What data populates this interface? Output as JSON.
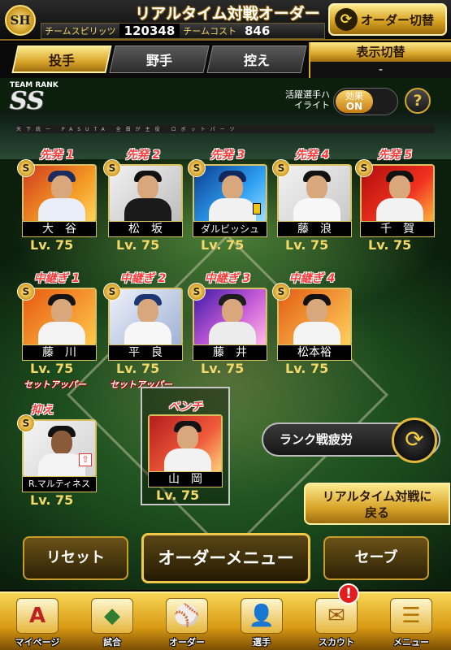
{
  "header": {
    "logo_text": "SH",
    "title": "リアルタイム対戦オーダー",
    "team_spirit_label": "チームスピリッツ",
    "team_spirit_value": "120348",
    "team_cost_label": "チームコスト",
    "team_cost_value": "846",
    "order_switch_label": "オーダー切替"
  },
  "tabs": [
    {
      "label": "投手",
      "active": true
    },
    {
      "label": "野手",
      "active": false
    },
    {
      "label": "控え",
      "active": false
    }
  ],
  "display_switch": {
    "label": "表示切替",
    "value": "-"
  },
  "team_rank": {
    "label": "TEAM RANK",
    "value": "SS"
  },
  "highlight": {
    "label": "活躍選手ハイライト",
    "effect_label": "効果",
    "effect_state": "ON"
  },
  "help_label": "?",
  "stadium_banner": "天下統一 PASUTA 全員が主役 ロボットパーツ",
  "rarity_mark": "S",
  "starters": [
    {
      "slot": "先発 1",
      "name": "大　谷",
      "level": "Lv. 75"
    },
    {
      "slot": "先発 2",
      "name": "松　坂",
      "level": "Lv. 75"
    },
    {
      "slot": "先発 3",
      "name": "ダルビッシュ",
      "level": "Lv. 75"
    },
    {
      "slot": "先発 4",
      "name": "藤　浪",
      "level": "Lv. 75"
    },
    {
      "slot": "先発 5",
      "name": "千　賀",
      "level": "Lv. 75"
    }
  ],
  "relievers": [
    {
      "slot": "中継ぎ 1",
      "name": "藤　川",
      "level": "Lv. 75",
      "sub": "セットアッパー"
    },
    {
      "slot": "中継ぎ 2",
      "name": "平　良",
      "level": "Lv. 75",
      "sub": "セットアッパー"
    },
    {
      "slot": "中継ぎ 3",
      "name": "藤　井",
      "level": "Lv. 75",
      "sub": ""
    },
    {
      "slot": "中継ぎ 4",
      "name": "松本裕",
      "level": "Lv. 75",
      "sub": ""
    }
  ],
  "closer": {
    "slot": "抑え",
    "name": "R.マルティネス",
    "level": "Lv. 75"
  },
  "bench": {
    "slot": "ベンチ",
    "name": "山　岡",
    "level": "Lv. 75"
  },
  "fatigue_button": "ランク戦疲労",
  "back_button": {
    "line1": "リアルタイム対戦に",
    "line2": "戻る"
  },
  "actions": {
    "reset": "リセット",
    "order_menu": "オーダーメニュー",
    "save": "セーブ"
  },
  "nav": [
    {
      "label": "マイページ",
      "icon": "A"
    },
    {
      "label": "試合",
      "icon": "◆"
    },
    {
      "label": "オーダー",
      "icon": "⚾"
    },
    {
      "label": "選手",
      "icon": "👤"
    },
    {
      "label": "スカウト",
      "icon": "✉"
    },
    {
      "label": "メニュー",
      "icon": "☰"
    }
  ],
  "scout_alert": "!",
  "colors": {
    "accent_gold": "#d9a52a",
    "slot_red": "#ff3b3b",
    "level_yellow": "#f5d86a"
  }
}
